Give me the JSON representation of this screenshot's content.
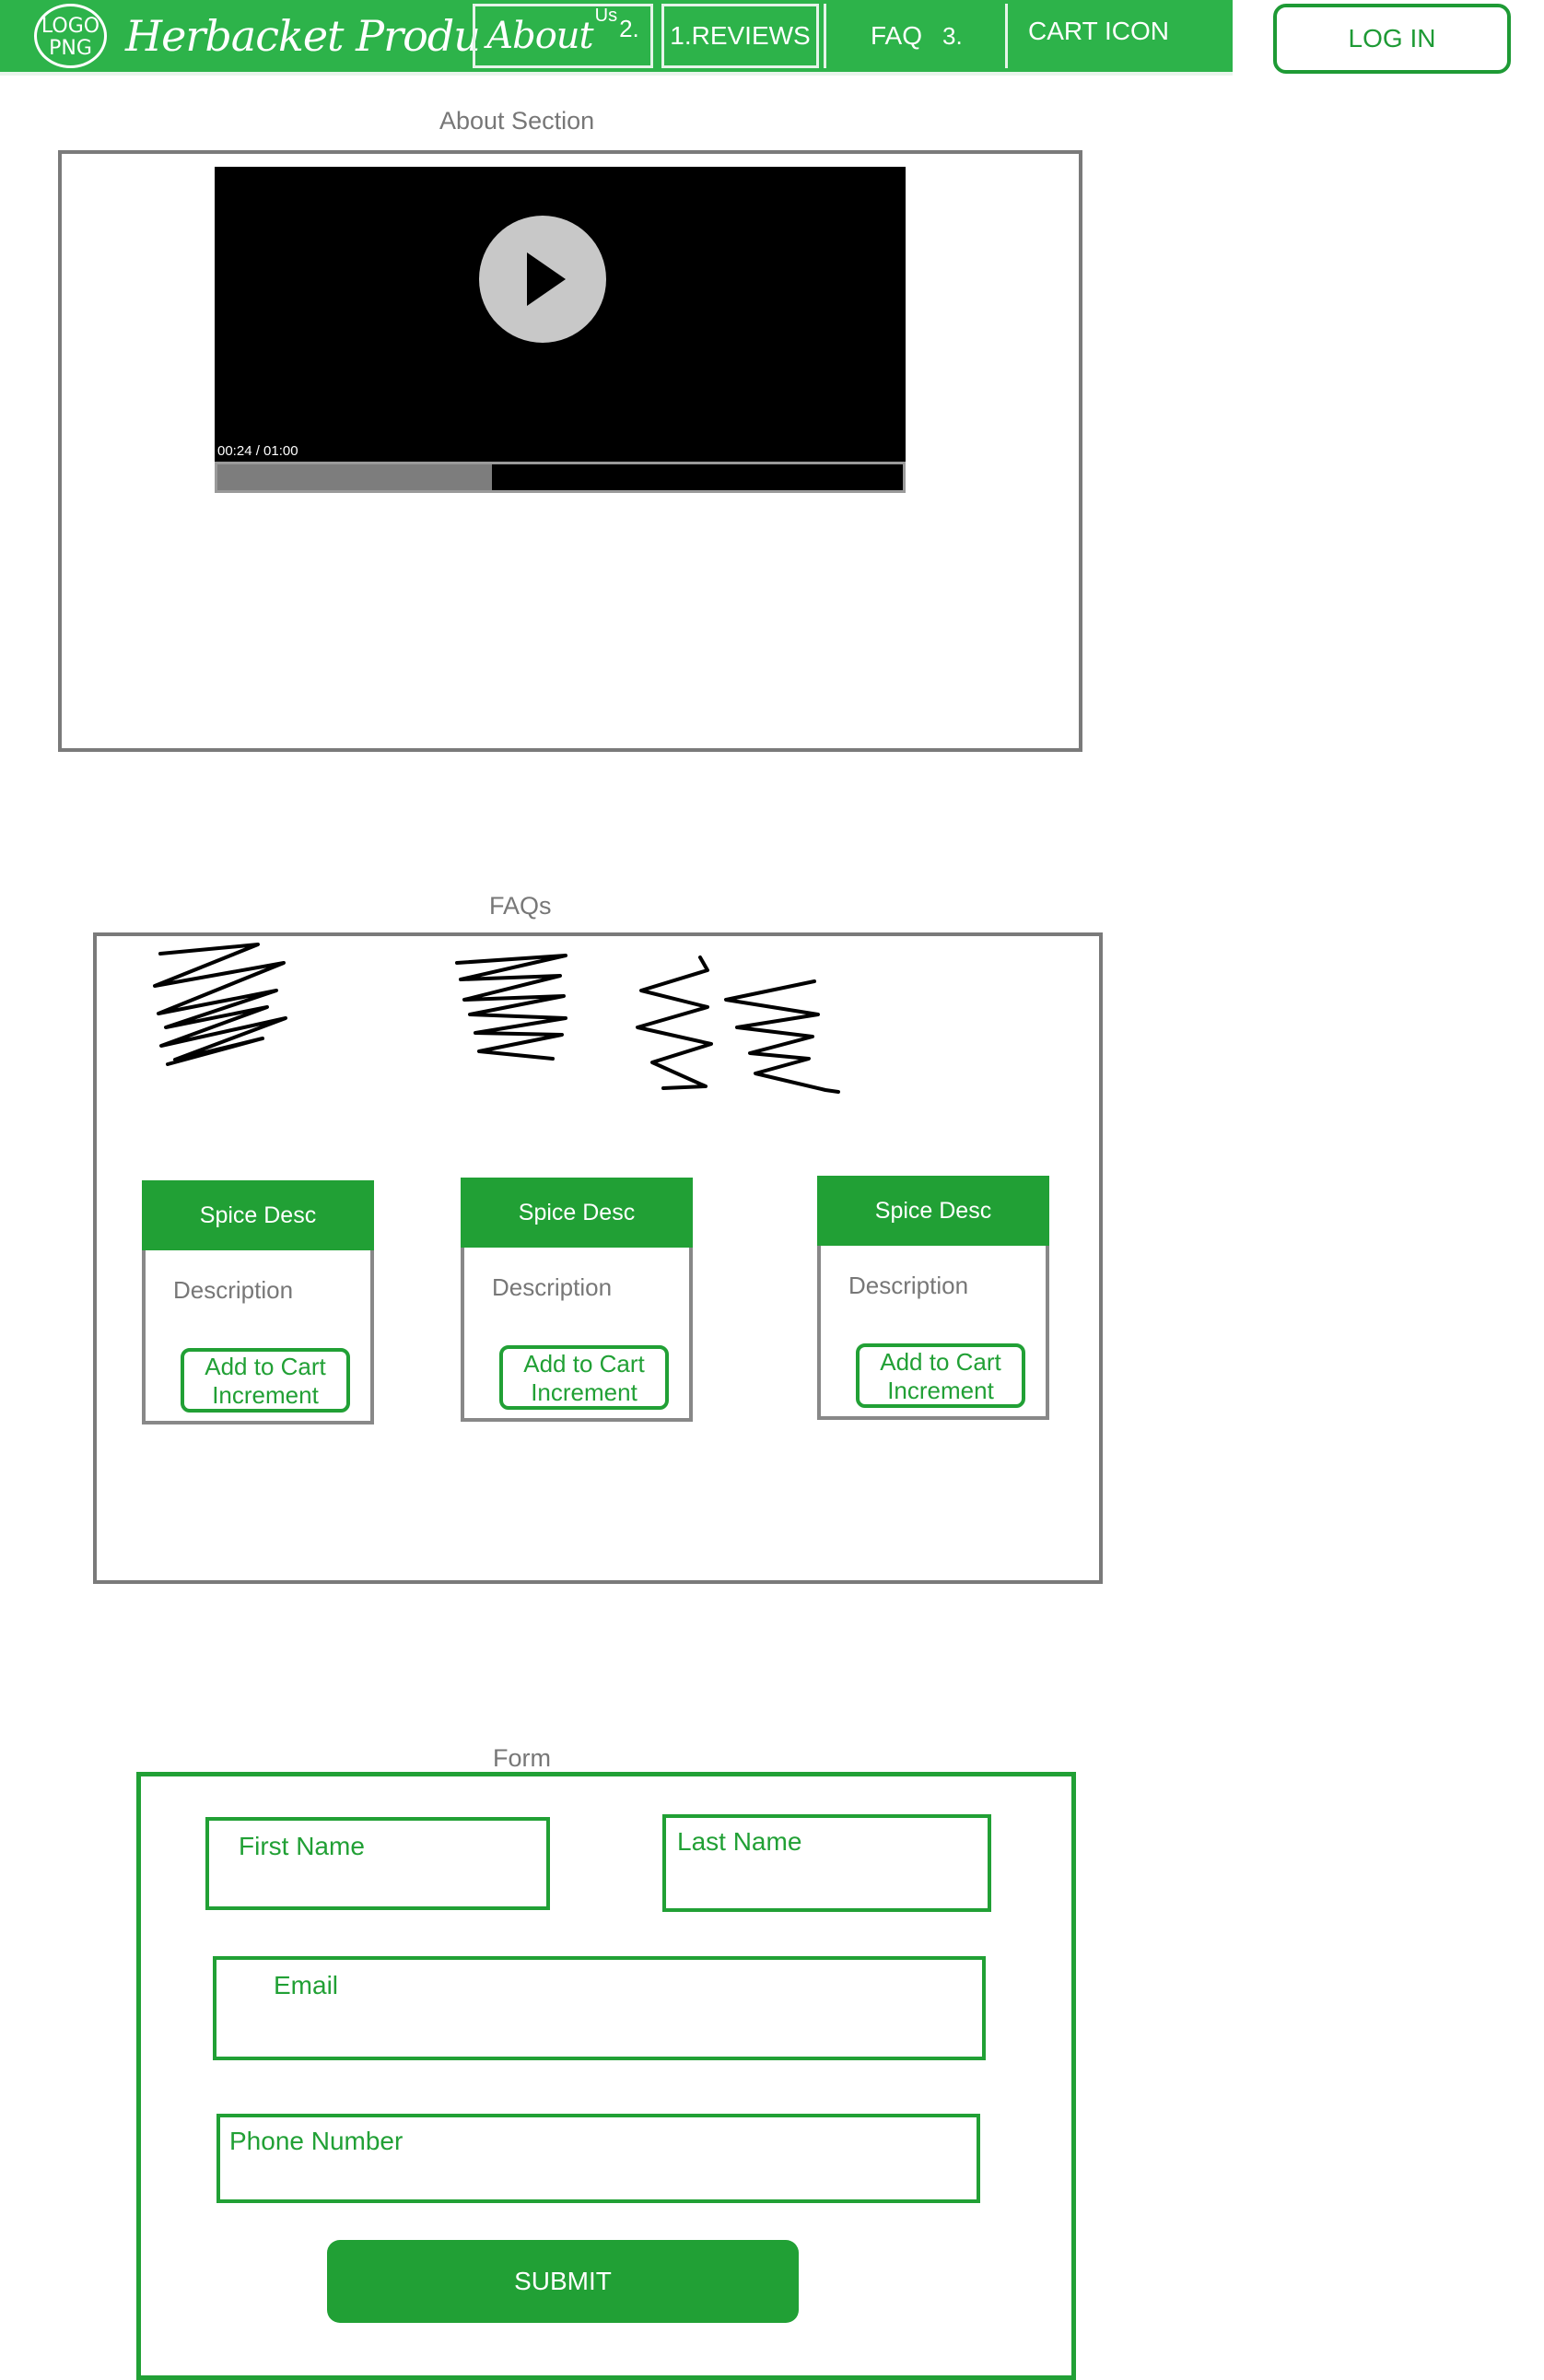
{
  "nav": {
    "logo_text": "LOGO\nPNG",
    "brand": "Herbacket Produ",
    "about_label": "About",
    "about_superscript": "Us",
    "about_number": "2.",
    "reviews_label": "1.REVIEWS",
    "faq_label": "FAQ",
    "faq_number": "3.",
    "cart_label": "CART ICON",
    "login_label": "LOG IN"
  },
  "about": {
    "section_label": "About Section",
    "video": {
      "time_display": "00:24 / 01:00",
      "progress_fraction": 0.4
    }
  },
  "faq": {
    "section_label": "FAQs",
    "cards": [
      {
        "title": "Spice Desc",
        "description": "Description",
        "button_line1": "Add to Cart",
        "button_line2": "Increment"
      },
      {
        "title": "Spice Desc",
        "description": "Description",
        "button_line1": "Add to Cart",
        "button_line2": "Increment"
      },
      {
        "title": "Spice Desc",
        "description": "Description",
        "button_line1": "Add to Cart",
        "button_line2": "Increment"
      }
    ]
  },
  "form": {
    "section_label": "Form",
    "first_name_label": "First Name",
    "last_name_label": "Last Name",
    "email_label": "Email",
    "phone_label": "Phone Number",
    "submit_label": "SUBMIT"
  },
  "colors": {
    "brand_green": "#2db34a",
    "dark_green": "#21a035",
    "border_gray": "#7a7a7a"
  }
}
